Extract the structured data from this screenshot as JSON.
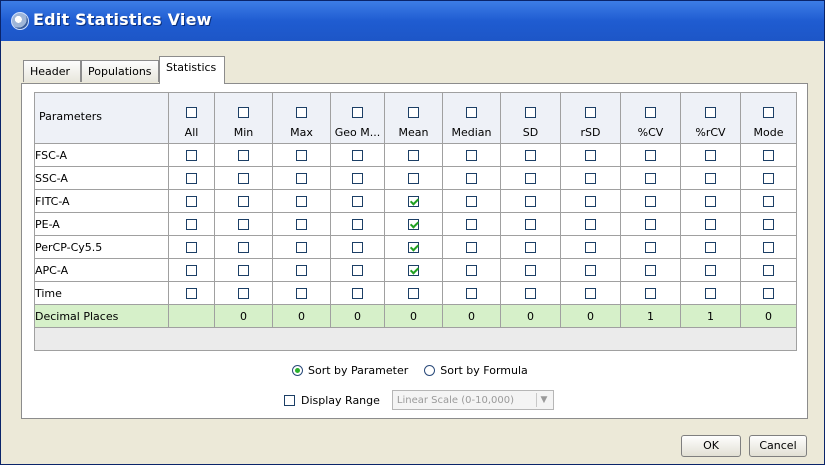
{
  "window": {
    "title": "Edit Statistics View"
  },
  "tabs": [
    {
      "label": "Header",
      "active": false
    },
    {
      "label": "Populations",
      "active": false
    },
    {
      "label": "Statistics",
      "active": true
    }
  ],
  "table": {
    "param_header": "Parameters",
    "columns": [
      "All",
      "Min",
      "Max",
      "Geo M...",
      "Mean",
      "Median",
      "SD",
      "rSD",
      "%CV",
      "%rCV",
      "Mode"
    ],
    "rows": [
      {
        "name": "FSC-A",
        "checked": [
          false,
          false,
          false,
          false,
          false,
          false,
          false,
          false,
          false,
          false,
          false
        ]
      },
      {
        "name": "SSC-A",
        "checked": [
          false,
          false,
          false,
          false,
          false,
          false,
          false,
          false,
          false,
          false,
          false
        ]
      },
      {
        "name": "FITC-A",
        "checked": [
          false,
          false,
          false,
          false,
          true,
          false,
          false,
          false,
          false,
          false,
          false
        ]
      },
      {
        "name": "PE-A",
        "checked": [
          false,
          false,
          false,
          false,
          true,
          false,
          false,
          false,
          false,
          false,
          false
        ]
      },
      {
        "name": "PerCP-Cy5.5",
        "checked": [
          false,
          false,
          false,
          false,
          true,
          false,
          false,
          false,
          false,
          false,
          false
        ]
      },
      {
        "name": "APC-A",
        "checked": [
          false,
          false,
          false,
          false,
          true,
          false,
          false,
          false,
          false,
          false,
          false
        ]
      },
      {
        "name": "Time",
        "checked": [
          false,
          false,
          false,
          false,
          false,
          false,
          false,
          false,
          false,
          false,
          false
        ]
      }
    ],
    "decimal_label": "Decimal Places",
    "decimal_values": [
      "",
      "0",
      "0",
      "0",
      "0",
      "0",
      "0",
      "0",
      "1",
      "1",
      "0"
    ]
  },
  "sort": {
    "by_parameter": "Sort by Parameter",
    "by_formula": "Sort by Formula",
    "selected": "parameter"
  },
  "range": {
    "label": "Display Range",
    "checked": false,
    "select_value": "Linear Scale (0-10,000)"
  },
  "buttons": {
    "ok": "OK",
    "cancel": "Cancel"
  },
  "colors": {
    "title_bar": "#1f5cd1",
    "decimal_row": "#d6f0c9",
    "check": "#21a121"
  }
}
